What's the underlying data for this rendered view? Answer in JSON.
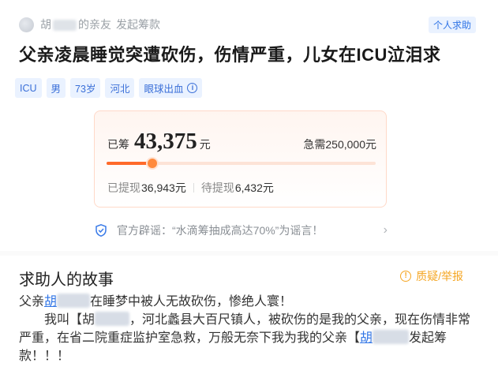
{
  "header": {
    "name_prefix": "胡",
    "name_suffix": "的亲友",
    "initiated": "发起筹款",
    "badge": "个人求助"
  },
  "title": "父亲凌晨睡觉突遭砍伤，伤情严重，儿女在ICU泣泪求",
  "tags": [
    "ICU",
    "男",
    "73岁",
    "河北",
    "眼球出血"
  ],
  "funding": {
    "raised_label": "已筹",
    "raised_amount": "43,375",
    "raised_unit": "元",
    "needed_text": "急需250,000元",
    "progress_fraction": 0.17,
    "withdrawn_label": "已提现",
    "withdrawn_value": "36,943元",
    "pending_label": "待提现",
    "pending_value": "6,432元"
  },
  "notice": {
    "text": "官方辟谣：“水滴筹抽成高达70%”为谣言！",
    "icon": "shield-check-icon"
  },
  "story": {
    "title": "求助人的故事",
    "report_label": "质疑/举报",
    "line1_prefix": "父亲",
    "line1_link": "胡",
    "line1_suffix": "在睡梦中被人无故砍伤，惨绝人寰！",
    "p2_prefix": "我叫【胡",
    "p2_text": "，河北蠡县大百尺镇人，被砍伤的是我的父亲，现在伤情非常严重，在省二院重症监护室急救，万般无奈下我为我的父亲【",
    "p2_link": "胡",
    "p2_suffix": "发起筹款！！！"
  },
  "colors": {
    "accent_orange": "#ff6a2a",
    "link_blue": "#2f74e6",
    "report_yellow": "#f5a623"
  }
}
